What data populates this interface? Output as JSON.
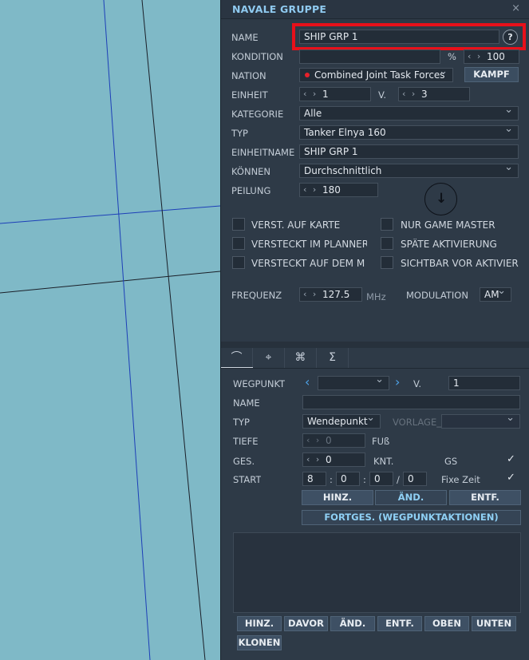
{
  "dialog": {
    "title": "NAVALE GRUPPE",
    "close": "×"
  },
  "group": {
    "name_label": "NAME",
    "name_value": "SHIP GRP 1",
    "help": "?",
    "condition_label": "KONDITION",
    "condition_unit": "%",
    "condition_value": "100",
    "nation_label": "NATION",
    "nation_value": "Combined Joint Task Forces",
    "nation_color": "#e8202a",
    "combat_button": "KAMPF",
    "unit_label": "EINHEIT",
    "unit_value": "1",
    "unit_of_label": "V.",
    "unit_total": "3",
    "category_label": "KATEGORIE",
    "category_value": "Alle",
    "type_label": "TYP",
    "type_value": "Tanker Elnya 160",
    "unitname_label": "EINHEITNAME",
    "unitname_value": "SHIP GRP 1",
    "skill_label": "KÖNNEN",
    "skill_value": "Durchschnittlich",
    "heading_label": "PEILUNG",
    "heading_value": "180",
    "checkboxes": [
      {
        "label": "VERST. AUF KARTE",
        "checked": false
      },
      {
        "label": "NUR GAME MASTER",
        "checked": false
      },
      {
        "label": "VERSTECKT IM PLANNER",
        "checked": false
      },
      {
        "label": "SPÄTE AKTIVIERUNG",
        "checked": false
      },
      {
        "label": "VERSTECKT AUF DEM MF",
        "checked": false
      },
      {
        "label": "SICHTBAR VOR AKTIVIERU",
        "checked": false
      }
    ],
    "freq_label": "FREQUENZ",
    "freq_value": "127.5",
    "freq_unit": "MHz",
    "modulation_label": "MODULATION",
    "modulation_value": "AM"
  },
  "tabs": [
    {
      "icon": "route-icon",
      "glyph": "⌒"
    },
    {
      "icon": "target-icon",
      "glyph": "⌖"
    },
    {
      "icon": "command-icon",
      "glyph": "⌘"
    },
    {
      "icon": "sigma-icon",
      "glyph": "Σ"
    }
  ],
  "waypoint": {
    "label": "WEGPUNKT",
    "of_label": "V.",
    "total": "1",
    "name_label": "NAME",
    "name_value": "",
    "type_label": "TYP",
    "type_value": "Wendepunkt",
    "template_label": "VORLAGE_",
    "depth_label": "TIEFE",
    "depth_value": "0",
    "depth_unit": "FUß",
    "speed_label": "GES.",
    "speed_value": "0",
    "speed_unit": "KNT.",
    "gs_label": "GS",
    "gs_checked": true,
    "start_label": "START",
    "start_h": "8",
    "start_m": "0",
    "start_s": "0",
    "start_d": "0",
    "fixed_label": "Fixe Zeit",
    "fixed_checked": true,
    "add_btn": "HINZ.",
    "edit_btn": "ÄND.",
    "del_btn": "ENTF.",
    "actions_btn": "FORTGES. (WEGPUNKTAKTIONEN)"
  },
  "actions_bar": [
    "HINZ.",
    "DAVOR",
    "ÄND.",
    "ENTF.",
    "OBEN",
    "UNTEN",
    "KLONEN"
  ]
}
